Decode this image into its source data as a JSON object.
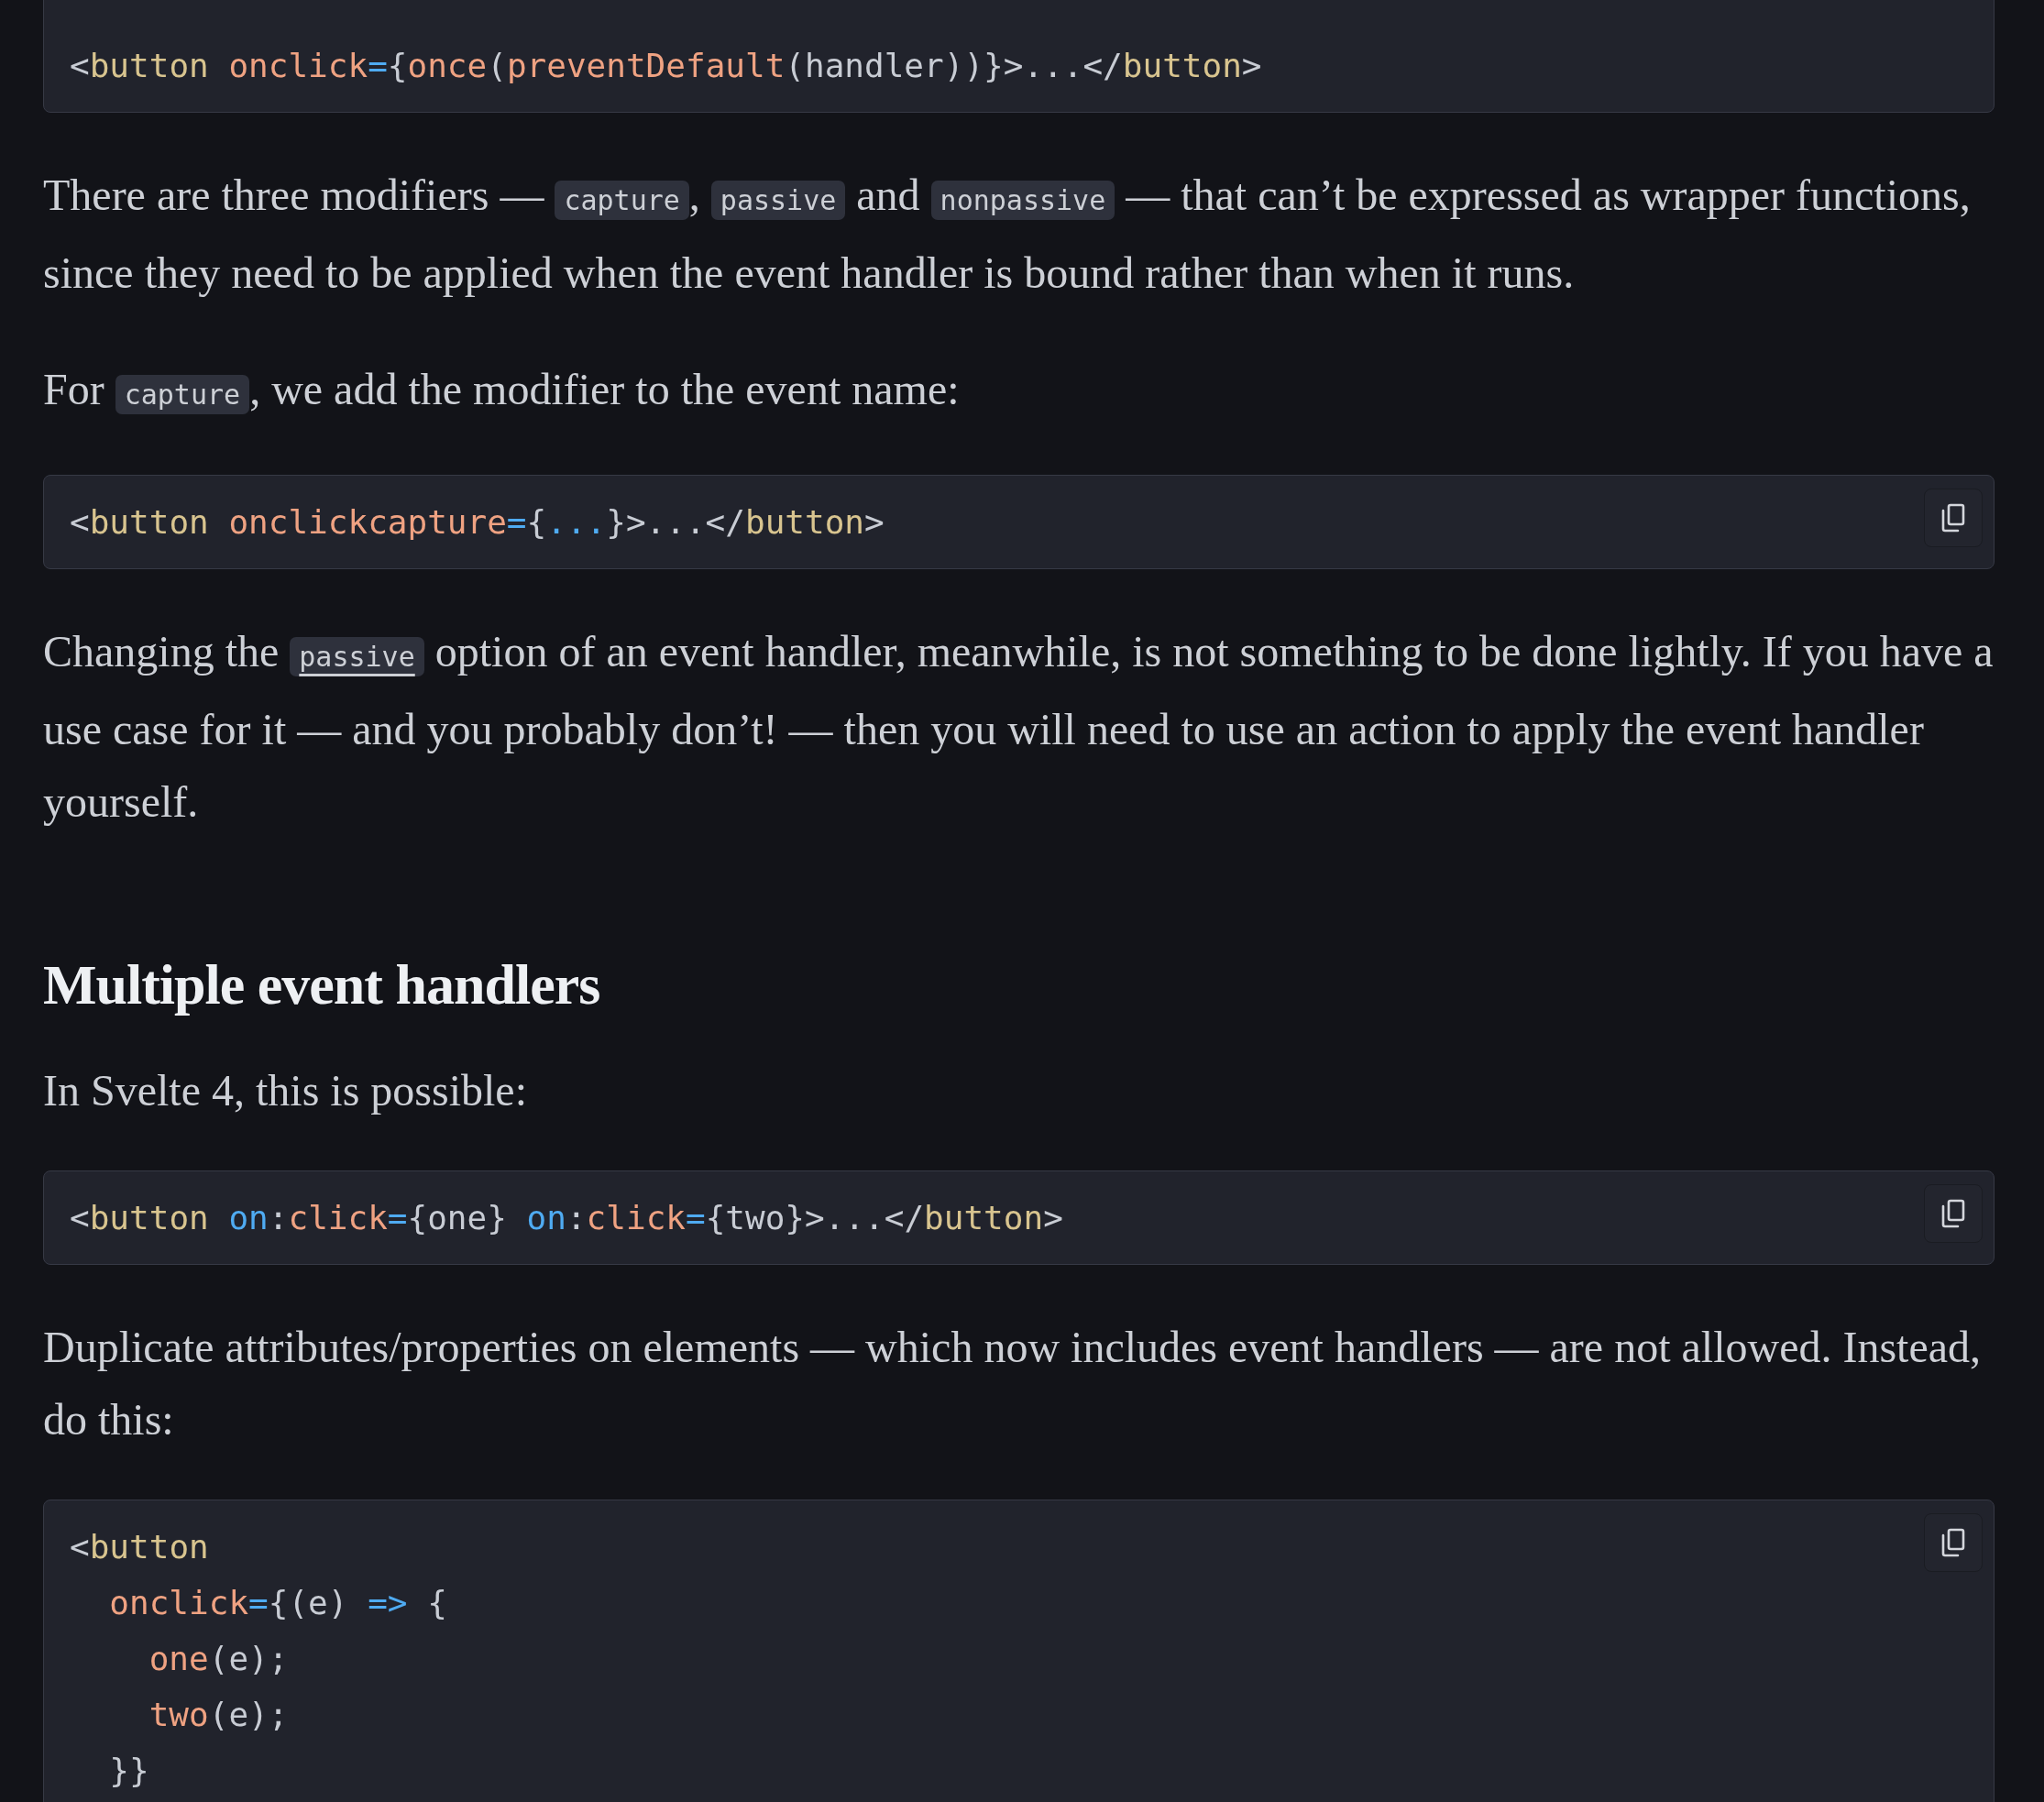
{
  "content": [
    {
      "kind": "code",
      "has_copy_button": false,
      "lines": [
        [
          {
            "kind": "punct",
            "t": "<"
          },
          {
            "kind": "tag",
            "t": "button"
          },
          {
            "kind": "fn",
            "t": " onclick"
          },
          {
            "kind": "op",
            "t": "="
          },
          {
            "kind": "punct",
            "t": "{"
          },
          {
            "kind": "fn",
            "t": "once"
          },
          {
            "kind": "punct",
            "t": "("
          },
          {
            "kind": "fn",
            "t": "preventDefault"
          },
          {
            "kind": "punct",
            "t": "(handler))}>...</"
          },
          {
            "kind": "tag",
            "t": "button"
          },
          {
            "kind": "punct",
            "t": ">"
          }
        ]
      ]
    },
    {
      "kind": "paragraph",
      "segments": [
        {
          "kind": "text",
          "t": "There are three modifiers — "
        },
        {
          "kind": "code",
          "t": "capture"
        },
        {
          "kind": "text",
          "t": ", "
        },
        {
          "kind": "code",
          "t": "passive"
        },
        {
          "kind": "text",
          "t": " and "
        },
        {
          "kind": "code",
          "t": "nonpassive"
        },
        {
          "kind": "text",
          "t": " — that can’t be expressed as wrapper functions, since they need to be applied when the event handler is bound rather than when it runs."
        }
      ]
    },
    {
      "kind": "paragraph",
      "segments": [
        {
          "kind": "text",
          "t": "For "
        },
        {
          "kind": "code",
          "t": "capture"
        },
        {
          "kind": "text",
          "t": ", we add the modifier to the event name:"
        }
      ]
    },
    {
      "kind": "code",
      "has_copy_button": true,
      "lines": [
        [
          {
            "kind": "punct",
            "t": "<"
          },
          {
            "kind": "tag",
            "t": "button"
          },
          {
            "kind": "fn",
            "t": " onclickcapture"
          },
          {
            "kind": "op",
            "t": "="
          },
          {
            "kind": "punct",
            "t": "{"
          },
          {
            "kind": "op",
            "t": "..."
          },
          {
            "kind": "punct",
            "t": "}>...</"
          },
          {
            "kind": "tag",
            "t": "button"
          },
          {
            "kind": "punct",
            "t": ">"
          }
        ]
      ]
    },
    {
      "kind": "paragraph",
      "segments": [
        {
          "kind": "text",
          "t": "Changing the "
        },
        {
          "kind": "link_code",
          "t": "passive"
        },
        {
          "kind": "text",
          "t": " option of an event handler, meanwhile, is not something to be done lightly. If you have a use case for it — and you probably don’t! — then you will need to use an action to apply the event handler yourself."
        }
      ]
    },
    {
      "kind": "heading",
      "text": "Multiple event handlers"
    },
    {
      "kind": "paragraph",
      "segments": [
        {
          "kind": "text",
          "t": "In Svelte 4, this is possible:"
        }
      ]
    },
    {
      "kind": "code",
      "has_copy_button": true,
      "lines": [
        [
          {
            "kind": "punct",
            "t": "<"
          },
          {
            "kind": "tag",
            "t": "button"
          },
          {
            "kind": "op",
            "t": " on"
          },
          {
            "kind": "punct",
            "t": ":"
          },
          {
            "kind": "fn",
            "t": "click"
          },
          {
            "kind": "op",
            "t": "="
          },
          {
            "kind": "punct",
            "t": "{one} "
          },
          {
            "kind": "op",
            "t": "on"
          },
          {
            "kind": "punct",
            "t": ":"
          },
          {
            "kind": "fn",
            "t": "click"
          },
          {
            "kind": "op",
            "t": "="
          },
          {
            "kind": "punct",
            "t": "{two}>...</"
          },
          {
            "kind": "tag",
            "t": "button"
          },
          {
            "kind": "punct",
            "t": ">"
          }
        ]
      ]
    },
    {
      "kind": "paragraph",
      "segments": [
        {
          "kind": "text",
          "t": "Duplicate attributes/properties on elements — which now includes event handlers — are not allowed. Instead, do this:"
        }
      ]
    },
    {
      "kind": "code",
      "has_copy_button": true,
      "lines": [
        [
          {
            "kind": "punct",
            "t": "<"
          },
          {
            "kind": "tag",
            "t": "button"
          }
        ],
        [
          {
            "kind": "fn",
            "t": "  onclick"
          },
          {
            "kind": "op",
            "t": "="
          },
          {
            "kind": "punct",
            "t": "{(e) "
          },
          {
            "kind": "op",
            "t": "=>"
          },
          {
            "kind": "punct",
            "t": " {"
          }
        ],
        [
          {
            "kind": "fn",
            "t": "    one"
          },
          {
            "kind": "punct",
            "t": "(e);"
          }
        ],
        [
          {
            "kind": "fn",
            "t": "    two"
          },
          {
            "kind": "punct",
            "t": "(e);"
          }
        ],
        [
          {
            "kind": "punct",
            "t": "  }}"
          }
        ]
      ]
    }
  ]
}
